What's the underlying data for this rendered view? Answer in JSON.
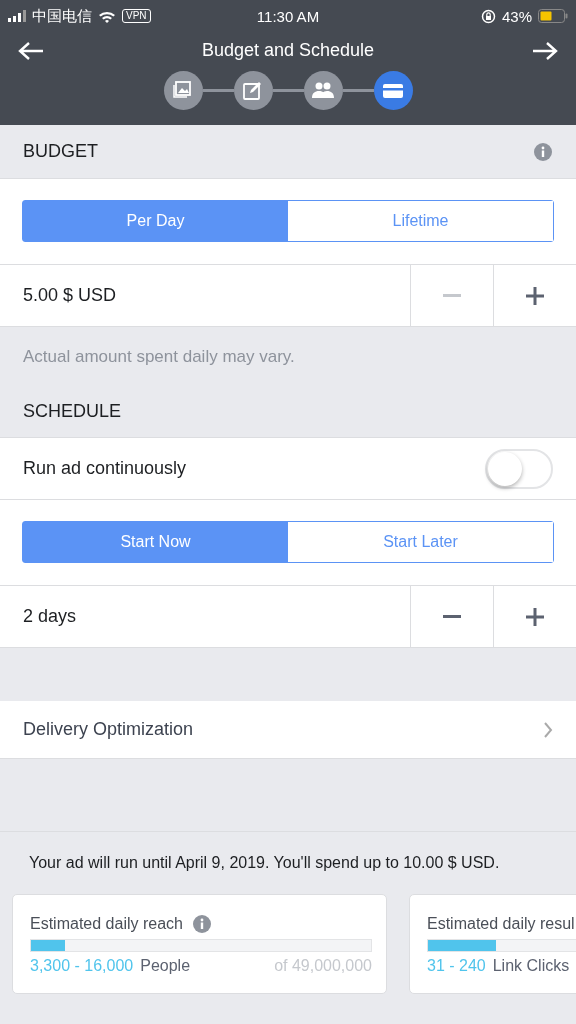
{
  "status_bar": {
    "carrier": "中国电信",
    "vpn": "VPN",
    "time": "11:30 AM",
    "battery_percent": "43%"
  },
  "header": {
    "title": "Budget and Schedule",
    "steps": [
      {
        "kind": "image",
        "selected": false
      },
      {
        "kind": "edit",
        "selected": false
      },
      {
        "kind": "people",
        "selected": false
      },
      {
        "kind": "card",
        "selected": true
      }
    ]
  },
  "budget": {
    "heading": "BUDGET",
    "tabs": [
      {
        "label": "Per Day",
        "selected": true
      },
      {
        "label": "Lifetime",
        "selected": false
      }
    ],
    "amount": "5.00 $ USD",
    "minus_disabled": true,
    "plus_disabled": false,
    "note": "Actual amount spent daily may vary."
  },
  "schedule": {
    "heading": "SCHEDULE",
    "continuous": {
      "label": "Run ad continuously",
      "on": false
    },
    "tabs": [
      {
        "label": "Start Now",
        "selected": true
      },
      {
        "label": "Start Later",
        "selected": false
      }
    ],
    "duration": "2 days",
    "minus_disabled": false,
    "plus_disabled": false
  },
  "delivery": {
    "label": "Delivery Optimization"
  },
  "summary": "Your ad will run until April 9, 2019. You'll spend up to 10.00 $ USD.",
  "estimates": [
    {
      "title": "Estimated daily reach",
      "info": true,
      "level": 0.1,
      "range": "3,300 - 16,000",
      "unit": "People",
      "total": "of 49,000,000"
    },
    {
      "title": "Estimated daily resul",
      "info": false,
      "level": 0.2,
      "range": "31 - 240",
      "unit": "Link Clicks"
    }
  ]
}
